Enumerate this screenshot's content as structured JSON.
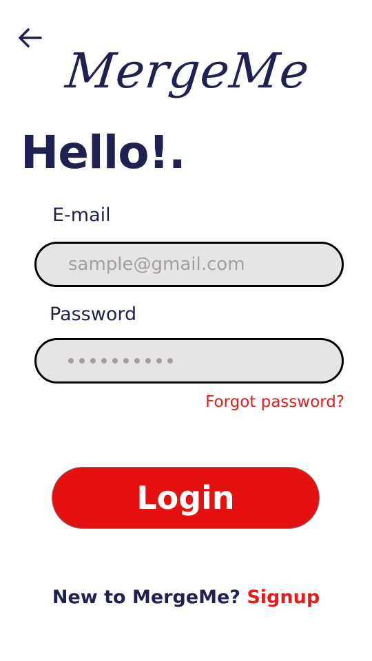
{
  "header": {
    "back_icon": "arrow-left-icon",
    "logo_text": "MergeMe"
  },
  "greeting": "Hello!.",
  "form": {
    "email": {
      "label": "E-mail",
      "placeholder": "sample@gmail.com",
      "value": ""
    },
    "password": {
      "label": "Password",
      "masked_length": 10
    },
    "forgot_password": "Forgot password?",
    "login_label": "Login"
  },
  "footer": {
    "prompt": "New to MergeMe?",
    "signup_label": "Signup"
  },
  "colors": {
    "primary_text": "#1f2150",
    "accent_red": "#e51111",
    "field_bg": "#e5e5e5",
    "placeholder": "#a89d9d"
  }
}
